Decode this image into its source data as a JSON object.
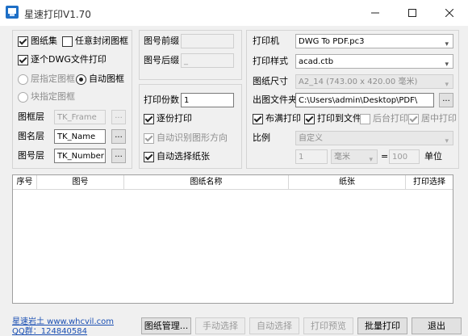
{
  "window": {
    "title": "星速打印V1.70",
    "minimize_icon": "minimize-icon",
    "maximize_icon": "maximize-icon",
    "close_icon": "close-icon"
  },
  "left_group": {
    "frame_set_label": "图纸集",
    "any_closed_frame_label": "任意封闭图框",
    "each_dwg_label": "逐个DWG文件打印",
    "layer_frame_label": "层指定图框",
    "auto_frame_label": "自动图框",
    "block_frame_label": "块指定图框",
    "frame_layer_label": "图框层",
    "frame_layer_value": "TK_Frame",
    "name_layer_label": "图名层",
    "name_layer_value": "TK_Name",
    "number_layer_label": "图号层",
    "number_layer_value": "TK_Number",
    "browse": "..."
  },
  "mid_group": {
    "prefix_label": "图号前缀",
    "prefix_value": "",
    "suffix_label": "图号后缀",
    "suffix_value": "_",
    "copies_label": "打印份数",
    "copies_value": "1",
    "collate_label": "逐份打印",
    "auto_orient_label": "自动识别图形方向",
    "auto_paper_label": "自动选择纸张"
  },
  "right_group": {
    "printer_label": "打印机",
    "printer_value": "DWG To PDF.pc3",
    "style_label": "打印样式",
    "style_value": "acad.ctb",
    "size_label": "图纸尺寸",
    "size_value": "A2_14 (743.00 x 420.00 毫米)",
    "folder_label": "出图文件夹",
    "folder_value": "C:\\Users\\admin\\Desktop\\PDF\\",
    "browse": "...",
    "fill_label": "布满打印",
    "to_file_label": "打印到文件",
    "background_label": "后台打印",
    "center_label": "居中打印",
    "scale_label": "比例",
    "scale_value": "自定义",
    "scale_left": "1",
    "unit_value": "毫米",
    "equals": "=",
    "scale_right": "100",
    "unit_label": "单位"
  },
  "table": {
    "columns": [
      "序号",
      "图号",
      "图纸名称",
      "纸张",
      "打印选择"
    ]
  },
  "footer": {
    "link1": "星速岩土 www.whcvil.com",
    "link2": "QQ群：124840584",
    "buttons": {
      "manage": "图纸管理...",
      "manual": "手动选择",
      "auto": "自动选择",
      "preview": "打印预览",
      "batch": "批量打印",
      "exit": "退出"
    }
  },
  "colors": {
    "accent": "#1e6fc6",
    "link": "#1a4fb3"
  }
}
